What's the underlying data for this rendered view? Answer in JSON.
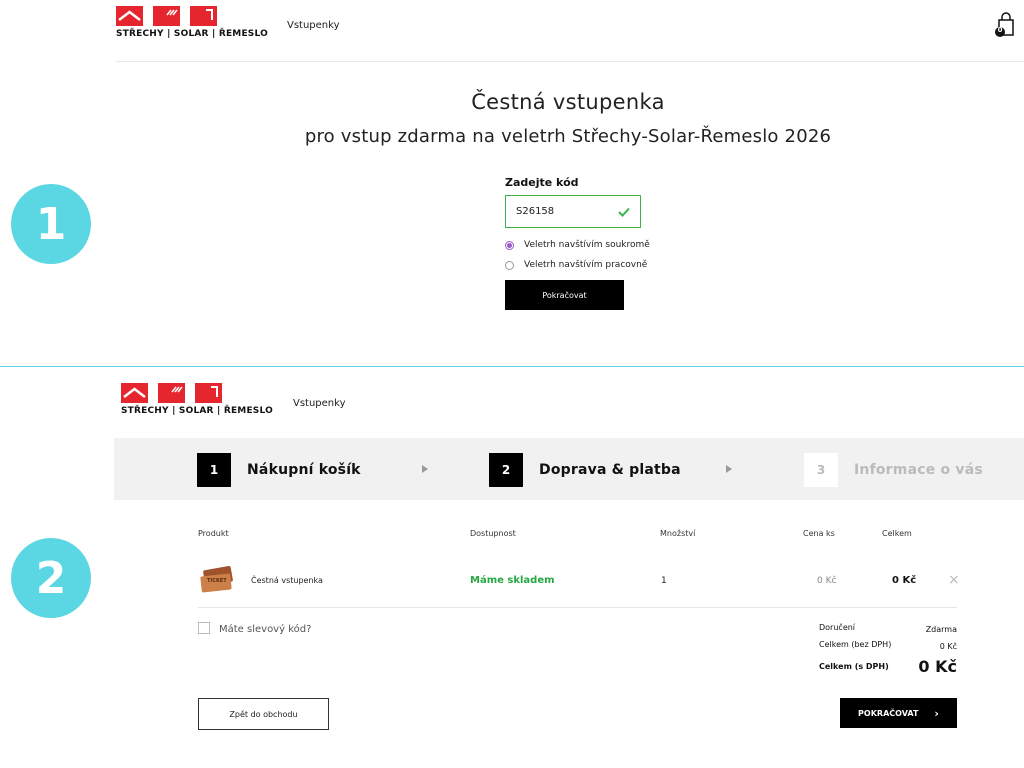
{
  "section1": {
    "badge": "1",
    "logo_text": "STŘECHY | SOLAR | ŘEMESLO",
    "nav_link": "Vstupenky",
    "cart_count": "0",
    "title": "Čestná vstupenka",
    "subtitle": "pro vstup zdarma na veletrh Střechy-Solar-Řemeslo 2026",
    "code_label": "Zadejte kód",
    "code_value": "S26158",
    "radio_options": [
      {
        "label": "Veletrh navštívím soukromě",
        "selected": true
      },
      {
        "label": "Veletrh navštívím pracovně",
        "selected": false
      }
    ],
    "continue_label": "Pokračovat"
  },
  "section2": {
    "badge": "2",
    "logo_text": "STŘECHY | SOLAR | ŘEMESLO",
    "nav_link": "Vstupenky",
    "steps": [
      {
        "num": "1",
        "label": "Nákupní košík",
        "active": true
      },
      {
        "num": "2",
        "label": "Doprava & platba",
        "active": true
      },
      {
        "num": "3",
        "label": "Informace o vás",
        "active": false
      }
    ],
    "table_headers": {
      "product": "Produkt",
      "availability": "Dostupnost",
      "quantity": "Množství",
      "unit_price": "Cena ks",
      "total": "Celkem"
    },
    "row": {
      "product_name": "Čestná vstupenka",
      "ticket_icon_text": "TICKET",
      "availability": "Máme skladem",
      "quantity": "1",
      "unit_price": "0 Kč",
      "total": "0 Kč",
      "remove": "×"
    },
    "discount_label": "Máte slevový kód?",
    "summary": {
      "delivery_label": "Doručení",
      "delivery_value": "Zdarma",
      "net_label": "Celkem (bez DPH)",
      "net_value": "0 Kč",
      "gross_label": "Celkem (s DPH)",
      "gross_value": "0 Kč"
    },
    "back_label": "Zpět do obchodu",
    "continue_label": "POKRAČOVAT",
    "continue_arrow": "›"
  },
  "colors": {
    "accent_cyan": "#5ad7e2",
    "brand_red": "#e5262e",
    "success_green": "#27a844"
  }
}
